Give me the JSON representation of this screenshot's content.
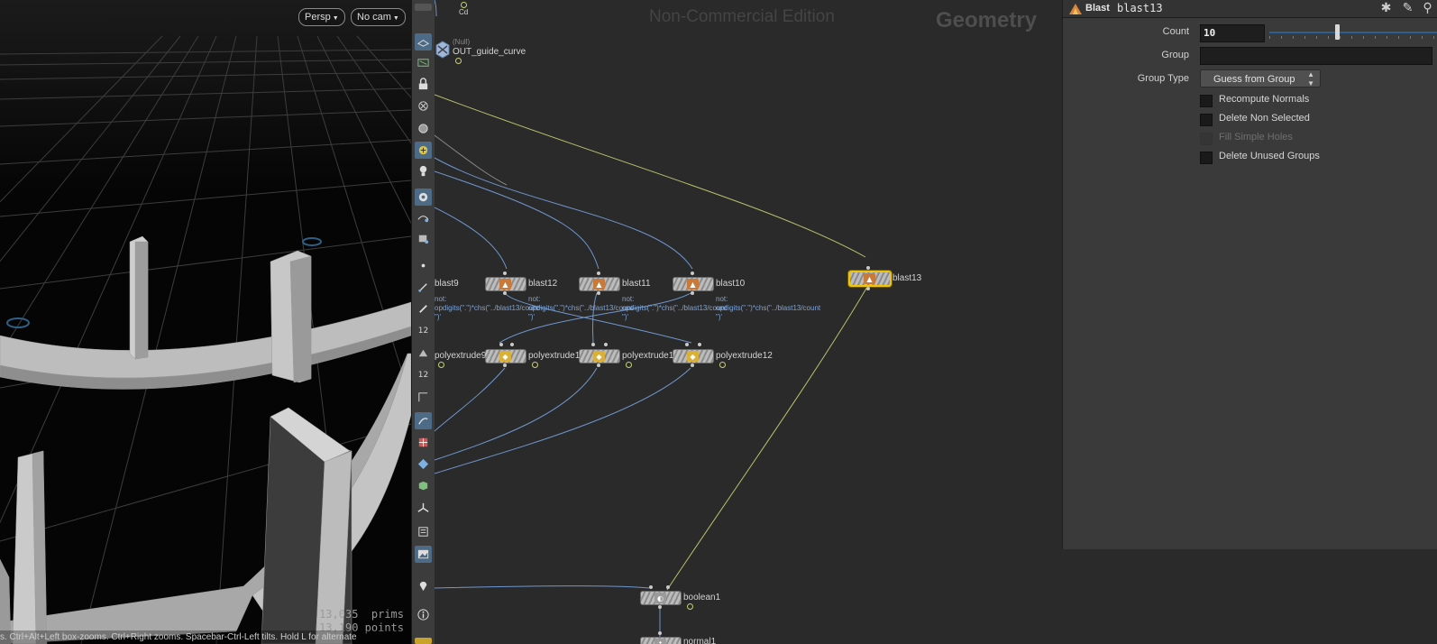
{
  "viewport": {
    "persp_label": "Persp",
    "cam_label": "No cam",
    "stats_prims": "13,035  prims",
    "stats_points": "13,190 points",
    "hint": "s. Ctrl+Alt+Left box-zooms. Ctrl+Right zooms. Spacebar-Ctrl-Left tilts. Hold L for alternate"
  },
  "toolbar": {
    "icons": [
      "select-icon",
      "view-icon",
      "lock-icon",
      "snap-icon",
      "ghost-icon",
      "display-icon",
      "skeleton-icon",
      "camera-icon",
      "scene-icon",
      "handle-icon",
      "point-icon",
      "brush-icon",
      "pen-icon",
      "tool12-icon",
      "paint-icon",
      "tool12b-icon",
      "angle-icon",
      "draw-icon",
      "uv-icon",
      "layout-icon",
      "cube-icon",
      "transform-icon",
      "viewer-icon",
      "image-icon",
      "pin-icon",
      "info-icon"
    ],
    "badge_12": "12",
    "badge_12b": "12"
  },
  "network": {
    "watermark": "Non-Commercial Edition",
    "context": "Geometry",
    "top_label_cd": "Cd",
    "null_type": "(Null)",
    "null_name": "OUT_guide_curve",
    "nodes": {
      "blast9": "blast9",
      "blast12": "blast12",
      "blast11": "blast11",
      "blast10": "blast10",
      "blast13": "blast13",
      "polyextrude9": "polyextrude9",
      "polyextrude1a": "polyextrude1",
      "polyextrude1b": "polyextrude1",
      "polyextrude12": "polyextrude12",
      "boolean1": "boolean1",
      "normal1": "normal1"
    },
    "comments": {
      "c1": "not:\nopdigits(\".\")*chs(\"../blast13/count\n\")'",
      "c2": "not:\nopdigits(\".\")*chs(\"../blast13/count\n\")'",
      "c3": "not:\nopdigits(\".\")*chs(\"../blast13/count\n\")'",
      "c4": "not:\nopdigits(\".\")*chs(\"../blast13/count\n\")'"
    }
  },
  "params": {
    "node_type": "Blast",
    "node_name": "blast13",
    "count_label": "Count",
    "count_value": "10",
    "count_slider_fraction": 0.4,
    "group_label": "Group",
    "group_value": "",
    "group_type_label": "Group Type",
    "group_type_value": "Guess from Group",
    "checkboxes": [
      {
        "label": "Recompute Normals",
        "checked": false,
        "enabled": true
      },
      {
        "label": "Delete Non Selected",
        "checked": false,
        "enabled": true
      },
      {
        "label": "Fill Simple Holes",
        "checked": false,
        "enabled": false
      },
      {
        "label": "Delete Unused Groups",
        "checked": false,
        "enabled": true
      }
    ]
  }
}
